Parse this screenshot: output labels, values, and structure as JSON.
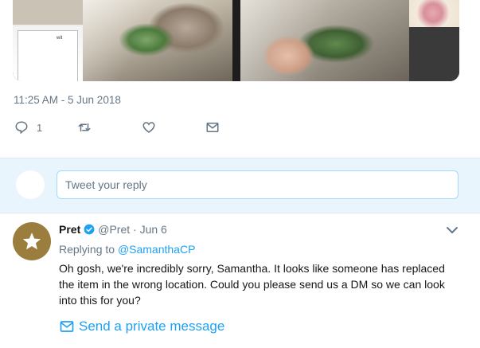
{
  "media": {
    "doc_snippet": "wit"
  },
  "tweet": {
    "timestamp": "11:25 AM - 5 Jun 2018",
    "actions": {
      "reply_count": "1",
      "reply_icon": "reply-icon",
      "retweet_icon": "retweet-icon",
      "like_icon": "heart-icon",
      "dm_icon": "envelope-icon"
    }
  },
  "reply_box": {
    "placeholder": "Tweet your reply"
  },
  "reply_tweet": {
    "name": "Pret",
    "handle": "@Pret",
    "separator": "·",
    "date": "Jun 6",
    "replying_prefix": "Replying to",
    "replying_to": "@SamanthaCP",
    "text": "Oh gosh, we're incredibly sorry, Samantha. It looks like someone has replaced the item in the wrong location. Could you please send us a DM so we can look into this for you?",
    "dm_label": "Send a private message"
  },
  "colors": {
    "accent": "#1da1f2",
    "muted": "#657786",
    "avatar_bg": "#9b7d3e",
    "reply_bar_bg": "#e8f5fd"
  }
}
